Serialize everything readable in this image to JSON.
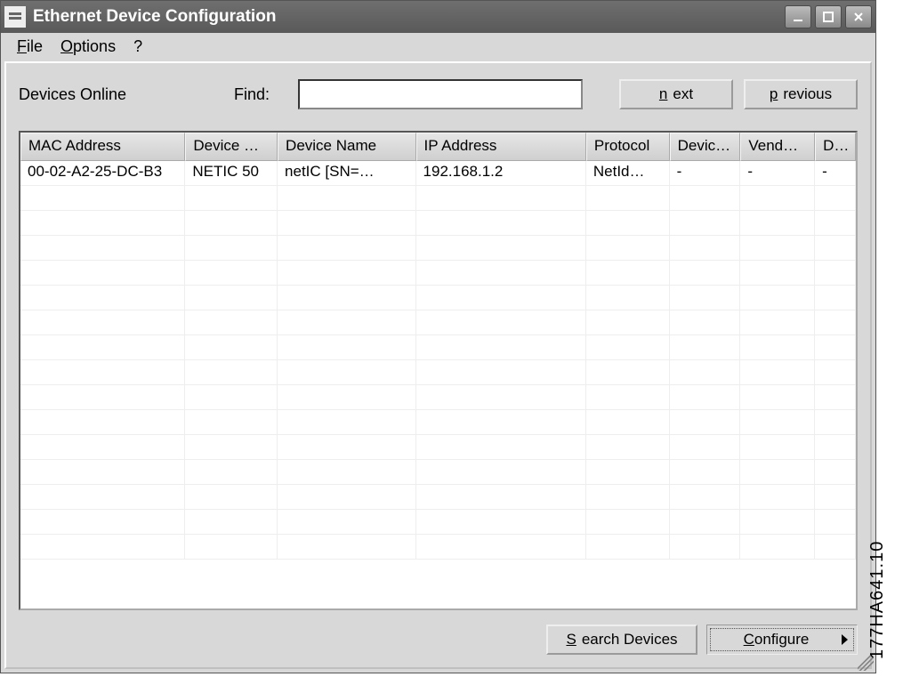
{
  "window": {
    "title": "Ethernet Device Configuration"
  },
  "menubar": {
    "file": "File",
    "options": "Options",
    "help": "?"
  },
  "toolbar": {
    "devices_label": "Devices Online",
    "find_label": "Find:",
    "find_value": "",
    "next_label": "next",
    "previous_label": "previous"
  },
  "table": {
    "columns": [
      "MAC Address",
      "Device …",
      "Device Name",
      "IP Address",
      "Protocol",
      "Devic…",
      "Vend…",
      "D…"
    ],
    "rows": [
      {
        "mac": "00-02-A2-25-DC-B3",
        "device_type": "NETIC 50",
        "device_name": "netIC [SN=…",
        "ip": "192.168.1.2",
        "protocol": "NetId…",
        "device_id": "-",
        "vendor": "-",
        "d": "-"
      }
    ]
  },
  "footer": {
    "search_label": "Search Devices",
    "configure_label": "Configure"
  },
  "side_label": "177HA641.10"
}
